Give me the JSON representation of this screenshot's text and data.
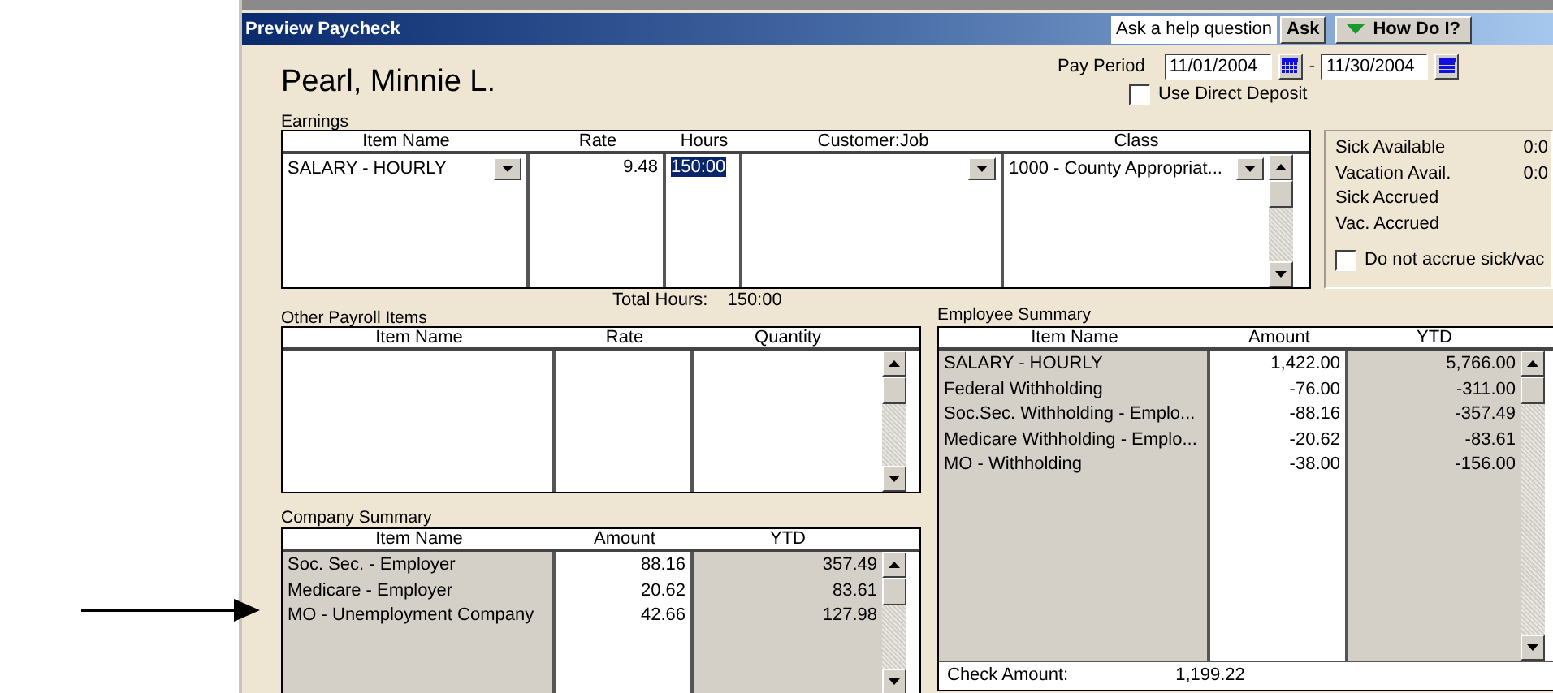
{
  "window": {
    "title": "Preview Paycheck"
  },
  "help_bar": {
    "question_field": "Ask a help question",
    "ask_button": "Ask",
    "how_do_i_button": "How Do I?"
  },
  "employee_name": "Pearl, Minnie L.",
  "pay_period": {
    "label": "Pay Period",
    "start": "11/01/2004",
    "separator": "-",
    "end": "11/30/2004"
  },
  "direct_deposit": {
    "label": "Use Direct Deposit",
    "checked": false
  },
  "earnings": {
    "title": "Earnings",
    "columns": [
      "Item Name",
      "Rate",
      "Hours",
      "Customer:Job",
      "Class"
    ],
    "rows": [
      {
        "item_name": "SALARY - HOURLY",
        "rate": "9.48",
        "hours": "150:00",
        "hours_selected": true,
        "class": "1000 - County Appropriat..."
      }
    ]
  },
  "accruals": {
    "items": [
      {
        "label": "Sick Available",
        "value": "0:0"
      },
      {
        "label": "Vacation Avail.",
        "value": "0:0"
      },
      {
        "label": "Sick Accrued"
      },
      {
        "label": "Vac. Accrued"
      }
    ],
    "do_not_accrue": {
      "label": "Do not accrue sick/vac",
      "checked": false
    }
  },
  "total_hours": {
    "label": "Total Hours:",
    "value": "150:00"
  },
  "other_payroll_items": {
    "title": "Other Payroll Items",
    "columns": [
      "Item Name",
      "Rate",
      "Quantity"
    ]
  },
  "company_summary": {
    "title": "Company Summary",
    "columns": [
      "Item Name",
      "Amount",
      "YTD"
    ],
    "rows": [
      {
        "item_name": "Soc. Sec. - Employer",
        "amount": "88.16",
        "ytd": "357.49"
      },
      {
        "item_name": "Medicare - Employer",
        "amount": "20.62",
        "ytd": "83.61"
      },
      {
        "item_name": "MO - Unemployment Company",
        "amount": "42.66",
        "ytd": "127.98"
      }
    ]
  },
  "employee_summary": {
    "title": "Employee Summary",
    "columns": [
      "Item Name",
      "Amount",
      "YTD"
    ],
    "rows": [
      {
        "item_name": "SALARY - HOURLY",
        "amount": "1,422.00",
        "ytd": "5,766.00"
      },
      {
        "item_name": "Federal Withholding",
        "amount": "-76.00",
        "ytd": "-311.00"
      },
      {
        "item_name": "Soc.Sec. Withholding - Emplo...",
        "amount": "-88.16",
        "ytd": "-357.49"
      },
      {
        "item_name": "Medicare Withholding - Emplo...",
        "amount": "-20.62",
        "ytd": "-83.61"
      },
      {
        "item_name": "MO - Withholding",
        "amount": "-38.00",
        "ytd": "-156.00"
      }
    ],
    "check_amount": {
      "label": "Check Amount:",
      "value": "1,199.22"
    }
  }
}
